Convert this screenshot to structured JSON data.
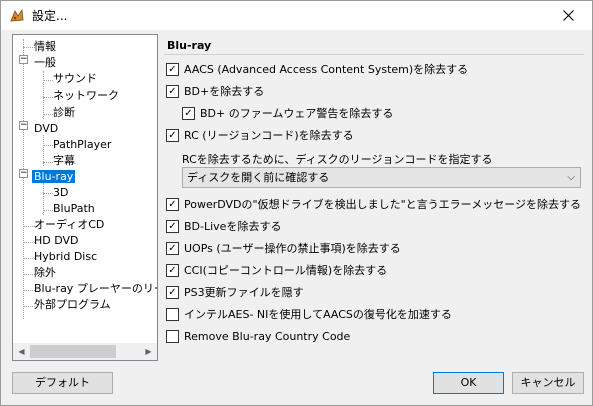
{
  "window": {
    "title": "設定..."
  },
  "tree": {
    "items": [
      {
        "label": "情報"
      },
      {
        "label": "一般"
      },
      {
        "label": "サウンド"
      },
      {
        "label": "ネットワーク"
      },
      {
        "label": "診断"
      },
      {
        "label": "DVD"
      },
      {
        "label": "PathPlayer"
      },
      {
        "label": "字幕"
      },
      {
        "label": "Blu-ray"
      },
      {
        "label": "3D"
      },
      {
        "label": "BluPath"
      },
      {
        "label": "オーディオCD"
      },
      {
        "label": "HD DVD"
      },
      {
        "label": "Hybrid Disc"
      },
      {
        "label": "除外"
      },
      {
        "label": "Blu-ray プレーヤーのリージ"
      },
      {
        "label": "外部プログラム"
      }
    ],
    "selected": "Blu-ray"
  },
  "panel": {
    "title": "Blu-ray",
    "options": [
      {
        "label": "AACS (Advanced Access Content System)を除去する",
        "checked": true
      },
      {
        "label": "BD+を除去する",
        "checked": true
      },
      {
        "label": "BD+ のファームウェア警告を除去する",
        "checked": true
      },
      {
        "label": "RC (リージョンコード)を除去する",
        "checked": true
      },
      {
        "label": "PowerDVDの\"仮想ドライブを検出しました\"と言うエラーメッセージを除去する",
        "checked": true
      },
      {
        "label": "BD-Liveを除去する",
        "checked": true
      },
      {
        "label": "UOPs (ユーザー操作の禁止事項)を除去する",
        "checked": true
      },
      {
        "label": "CCI(コピーコントロール情報)を除去する",
        "checked": true
      },
      {
        "label": "PS3更新ファイルを隠す",
        "checked": true
      },
      {
        "label": "インテルAES- NIを使用してAACSの復号化を加速する",
        "checked": false
      },
      {
        "label": "Remove Blu-ray Country Code",
        "checked": false
      }
    ],
    "region_label": "RCを除去するために、ディスクのリージョンコードを指定する",
    "region_select": "ディスクを開く前に確認する"
  },
  "buttons": {
    "default": "デフォルト",
    "ok": "OK",
    "cancel": "キャンセル"
  }
}
